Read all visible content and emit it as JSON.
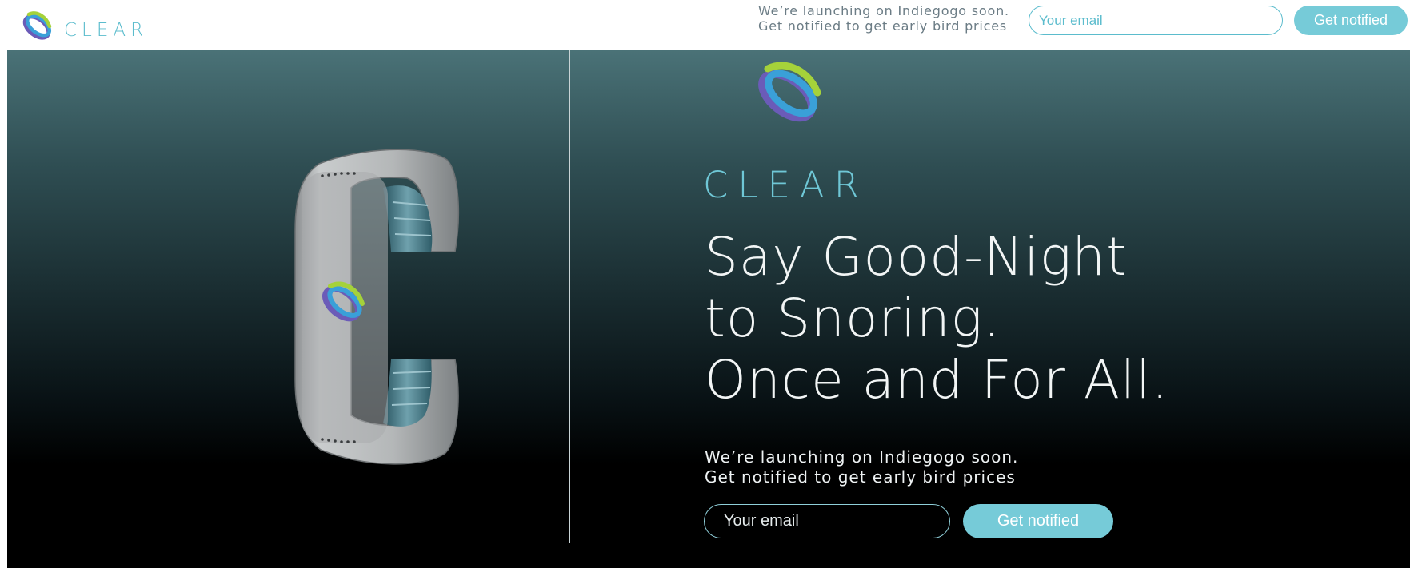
{
  "header": {
    "brand_name": "CLEAR",
    "logo_icon": "clear-swirl-logo",
    "promo_line1": "We’re launching on Indiegogo soon.",
    "promo_line2": "Get notified to get early bird prices",
    "email_placeholder": "Your email",
    "email_value": "",
    "button_label": "Get notified"
  },
  "hero": {
    "logo_icon": "clear-swirl-logo",
    "brand_name": "CLEAR",
    "headline": [
      "Say Good-Night",
      "to Snoring.",
      "Once and For All."
    ],
    "promo_line1": "We’re launching on Indiegogo soon.",
    "promo_line2": "Get notified to get early bird prices",
    "email_placeholder": "Your email",
    "email_value": "",
    "button_label": "Get notified",
    "product_image": "clear-wristband-device"
  },
  "colors": {
    "accent": "#76cbd8",
    "brand_text": "#5bbccd",
    "logo_green": "#a5d23a",
    "logo_blue": "#3aa0d8",
    "logo_purple": "#6b5bb8",
    "hero_top": "#4a7277",
    "hero_bottom": "#000000"
  }
}
